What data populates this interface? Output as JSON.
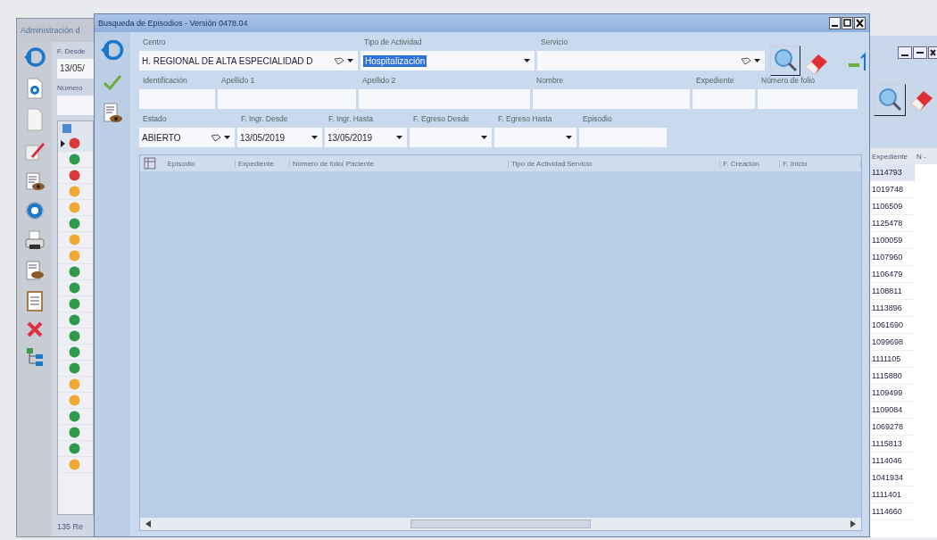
{
  "left_window": {
    "title": "Administración d",
    "date_label": "F. Desde",
    "date_value": "13/05/",
    "number_label": "Número",
    "status": "135 Re",
    "rows": [
      {
        "color": "#d83a3a",
        "selected": true
      },
      {
        "color": "#2e9a4a",
        "selected": false
      },
      {
        "color": "#d83a3a",
        "selected": false
      },
      {
        "color": "#f0a830",
        "selected": false
      },
      {
        "color": "#f0a830",
        "selected": false
      },
      {
        "color": "#2e9a4a",
        "selected": false
      },
      {
        "color": "#f0a830",
        "selected": false
      },
      {
        "color": "#f0a830",
        "selected": false
      },
      {
        "color": "#2e9a4a",
        "selected": false
      },
      {
        "color": "#2e9a4a",
        "selected": false
      },
      {
        "color": "#2e9a4a",
        "selected": false
      },
      {
        "color": "#2e9a4a",
        "selected": false
      },
      {
        "color": "#2e9a4a",
        "selected": false
      },
      {
        "color": "#2e9a4a",
        "selected": false
      },
      {
        "color": "#2e9a4a",
        "selected": false
      },
      {
        "color": "#f0a830",
        "selected": false
      },
      {
        "color": "#f0a830",
        "selected": false
      },
      {
        "color": "#2e9a4a",
        "selected": false
      },
      {
        "color": "#2e9a4a",
        "selected": false
      },
      {
        "color": "#2e9a4a",
        "selected": false
      },
      {
        "color": "#f0a830",
        "selected": false
      }
    ]
  },
  "window": {
    "title": "Busqueda de Episodios - Versión 0478.04",
    "form_rows": [
      [
        {
          "label": "Centro",
          "value": "H. REGIONAL DE ALTA ESPECIALIDAD D",
          "kind": "filter_combo",
          "selected": false
        },
        {
          "label": "Tipo de Actividad",
          "value": "Hospitalización",
          "kind": "combo",
          "selected": true
        },
        {
          "label": "Servicio",
          "kind": "filter_combo",
          "selected": false
        }
      ],
      [
        {
          "label": "Identificación",
          "kind": "text",
          "selected": false
        },
        {
          "label": "Apellido 1",
          "kind": "text",
          "selected": false
        },
        {
          "label": "Apellido 2",
          "kind": "text",
          "selected": false
        },
        {
          "label": "Nombre",
          "kind": "text",
          "selected": false
        },
        {
          "label": "Expediente",
          "kind": "text",
          "selected": false
        },
        {
          "label": "Número de folio",
          "kind": "text",
          "selected": false
        }
      ],
      [
        {
          "label": "Estado",
          "value": "ABIERTO",
          "kind": "filter_combo",
          "selected": false
        },
        {
          "label": "F. Ingr. Desde",
          "value": "13/05/2019",
          "kind": "combo",
          "selected": false
        },
        {
          "label": "F. Ingr. Hasta",
          "value": "13/05/2019",
          "kind": "combo",
          "selected": false
        },
        {
          "label": "F. Egreso Desde",
          "kind": "combo",
          "selected": false
        },
        {
          "label": "F. Egreso Hasta",
          "kind": "combo",
          "selected": false
        },
        {
          "label": "Episodio",
          "kind": "text",
          "selected": false
        }
      ]
    ],
    "table": {
      "columns": [
        "Episodio",
        "Expediente",
        "Número de folio",
        "Paciente",
        "Tipo de Actividad",
        "Servicio",
        "F. Creación",
        "F. Inicio"
      ]
    }
  },
  "right_window": {
    "columns": [
      "Expediente",
      "N -"
    ],
    "rows": [
      {
        "expediente": "1114793",
        "selected": true
      },
      {
        "expediente": "1019748",
        "selected": false
      },
      {
        "expediente": "1106509",
        "selected": false
      },
      {
        "expediente": "1125478",
        "selected": false
      },
      {
        "expediente": "1100059",
        "selected": false
      },
      {
        "expediente": "1107960",
        "selected": false
      },
      {
        "expediente": "1106479",
        "selected": false
      },
      {
        "expediente": "1108811",
        "selected": false
      },
      {
        "expediente": "1113896",
        "selected": false
      },
      {
        "expediente": "1061690",
        "selected": false
      },
      {
        "expediente": "1099698",
        "selected": false
      },
      {
        "expediente": "1111105",
        "selected": false
      },
      {
        "expediente": "1115880",
        "selected": false
      },
      {
        "expediente": "1109499",
        "selected": false
      },
      {
        "expediente": "1109084",
        "selected": false
      },
      {
        "expediente": "1069278",
        "selected": false
      },
      {
        "expediente": "1115813",
        "selected": false
      },
      {
        "expediente": "1114046",
        "selected": false
      },
      {
        "expediente": "1041934",
        "selected": false
      },
      {
        "expediente": "1111401",
        "selected": false
      },
      {
        "expediente": "1114660",
        "selected": false
      }
    ]
  }
}
